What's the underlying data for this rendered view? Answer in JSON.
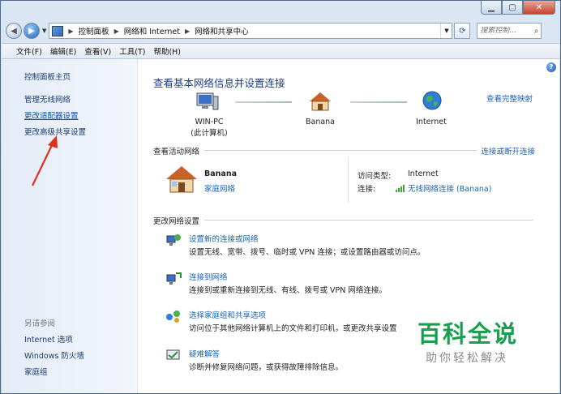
{
  "window": {
    "min_icon": "minimize-icon",
    "max_icon": "maximize-icon",
    "close_icon": "close-icon"
  },
  "address": {
    "crumbs": [
      "控制面板",
      "网络和 Internet",
      "网络和共享中心"
    ],
    "search_placeholder": "搜索控制..."
  },
  "menu": [
    "文件(F)",
    "编辑(E)",
    "查看(V)",
    "工具(T)",
    "帮助(H)"
  ],
  "sidebar": {
    "home": "控制面板主页",
    "links": [
      "管理无线网络",
      "更改适配器设置",
      "更改高级共享设置"
    ],
    "see_also_label": "另请参阅",
    "see_also": [
      "Internet 选项",
      "Windows 防火墙",
      "家庭组"
    ]
  },
  "main": {
    "title": "查看基本网络信息并设置连接",
    "full_map": "查看完整映射",
    "nodes": [
      {
        "line1": "WIN-PC",
        "line2": "(此计算机)"
      },
      {
        "line1": "Banana",
        "line2": ""
      },
      {
        "line1": "Internet",
        "line2": ""
      }
    ],
    "active_networks_label": "查看活动网络",
    "connect_disconnect": "连接或断开连接",
    "network_name": "Banana",
    "network_type": "家庭网络",
    "access_type_label": "访问类型:",
    "access_type_value": "Internet",
    "connection_label": "连接:",
    "connection_value": "无线网络连接 (Banana)",
    "change_settings_label": "更改网络设置",
    "tasks": [
      {
        "title": "设置新的连接或网络",
        "desc": "设置无线、宽带、拨号、临时或 VPN 连接；或设置路由器或访问点。"
      },
      {
        "title": "连接到网络",
        "desc": "连接到或重新连接到无线、有线、拨号或 VPN 网络连接。"
      },
      {
        "title": "选择家庭组和共享选项",
        "desc": "访问位于其他网络计算机上的文件和打印机，或更改共享设置"
      },
      {
        "title": "疑难解答",
        "desc": "诊断并修复网络问题，或获得故障排除信息。"
      }
    ]
  },
  "watermark": {
    "line1": "百科全说",
    "line2": "助你轻松解决"
  },
  "colors": {
    "link": "#1a64b8",
    "title": "#1d3d8a",
    "watermark": "#17a14d",
    "annotation_arrow": "#e03020"
  }
}
